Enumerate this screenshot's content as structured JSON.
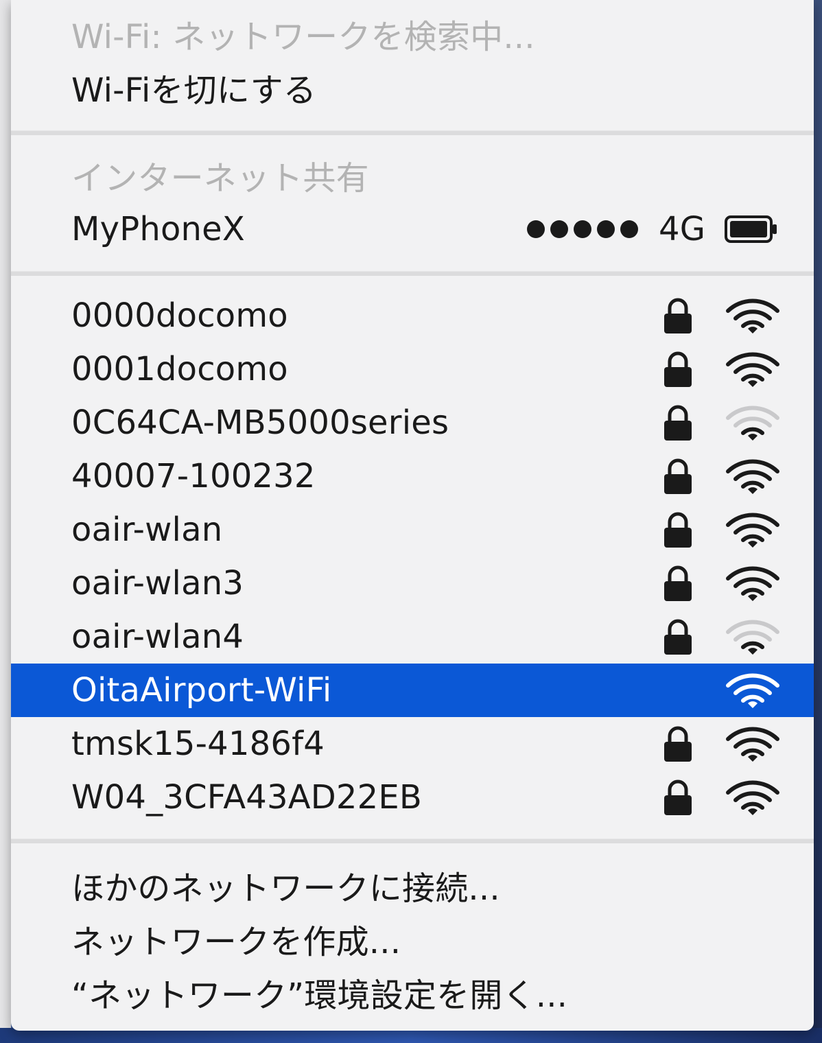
{
  "wifi_status": {
    "searching_label": "Wi-Fi: ネットワークを検索中...",
    "toggle_label": "Wi-Fiを切にする"
  },
  "hotspot": {
    "section_title": "インターネット共有",
    "device_name": "MyPhoneX",
    "signal_bars": 5,
    "network_type": "4G",
    "battery_icon": "battery-icon"
  },
  "networks": [
    {
      "name": "0000docomo",
      "locked": true,
      "signal": "full"
    },
    {
      "name": "0001docomo",
      "locked": true,
      "signal": "full"
    },
    {
      "name": "0C64CA-MB5000series",
      "locked": true,
      "signal": "weak"
    },
    {
      "name": "40007-100232",
      "locked": true,
      "signal": "full"
    },
    {
      "name": "oair-wlan",
      "locked": true,
      "signal": "full"
    },
    {
      "name": "oair-wlan3",
      "locked": true,
      "signal": "full"
    },
    {
      "name": "oair-wlan4",
      "locked": true,
      "signal": "weak"
    },
    {
      "name": "OitaAirport-WiFi",
      "locked": false,
      "signal": "full",
      "selected": true
    },
    {
      "name": "tmsk15-4186f4",
      "locked": true,
      "signal": "full"
    },
    {
      "name": "W04_3CFA43AD22EB",
      "locked": true,
      "signal": "full"
    }
  ],
  "footer": {
    "join_other": "ほかのネットワークに接続...",
    "create_network": "ネットワークを作成...",
    "open_prefs": "“ネットワーク”環境設定を開く..."
  },
  "colors": {
    "selection": "#0b58d6",
    "menu_background": "#f2f2f3",
    "disabled_text": "#b3b3b3",
    "text": "#1a1a1a"
  }
}
